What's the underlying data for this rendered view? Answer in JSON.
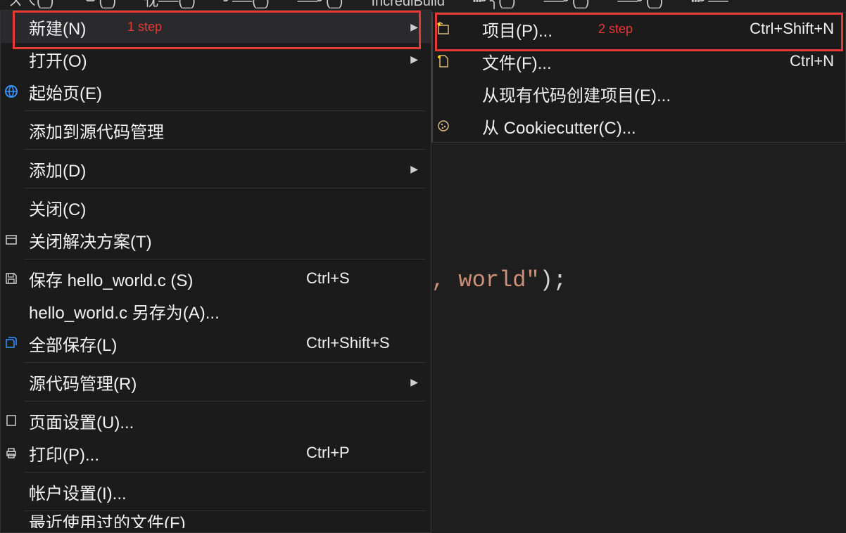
{
  "menubar": {
    "items": [
      "ㄨㄟ(_)",
      "╰╯(_)",
      "忱──(_)",
      "╯──(_)",
      "──╯(_)",
      "IncrediBuild",
      "┅╯╮(_)",
      "──╯(_)",
      "──╯(_)",
      "┅╯──"
    ]
  },
  "annotations": {
    "step1": "1 step",
    "step2": "2 step"
  },
  "file_menu": {
    "new": {
      "label": "新建(N)",
      "has_submenu": true
    },
    "open": {
      "label": "打开(O)",
      "has_submenu": true
    },
    "start_page": {
      "label": "起始页(E)"
    },
    "add_to_scc": {
      "label": "添加到源代码管理"
    },
    "add": {
      "label": "添加(D)",
      "has_submenu": true
    },
    "close": {
      "label": "关闭(C)"
    },
    "close_solution": {
      "label": "关闭解决方案(T)"
    },
    "save": {
      "label": "保存 hello_world.c (S)",
      "shortcut": "Ctrl+S"
    },
    "save_as": {
      "label": "hello_world.c 另存为(A)..."
    },
    "save_all": {
      "label": "全部保存(L)",
      "shortcut": "Ctrl+Shift+S"
    },
    "source_control": {
      "label": "源代码管理(R)",
      "has_submenu": true
    },
    "page_setup": {
      "label": "页面设置(U)..."
    },
    "print": {
      "label": "打印(P)...",
      "shortcut": "Ctrl+P"
    },
    "account": {
      "label": "帐户设置(I)..."
    },
    "recent_files": {
      "label": "最近使用过的文件(F)"
    }
  },
  "new_submenu": {
    "project": {
      "label": "项目(P)...",
      "shortcut": "Ctrl+Shift+N"
    },
    "file": {
      "label": "文件(F)...",
      "shortcut": "Ctrl+N"
    },
    "from_existing": {
      "label": "从现有代码创建项目(E)..."
    },
    "cookiecutter": {
      "label": "从 Cookiecutter(C)..."
    }
  },
  "code": {
    "visible_text": ", world\"",
    "punct": ");"
  }
}
